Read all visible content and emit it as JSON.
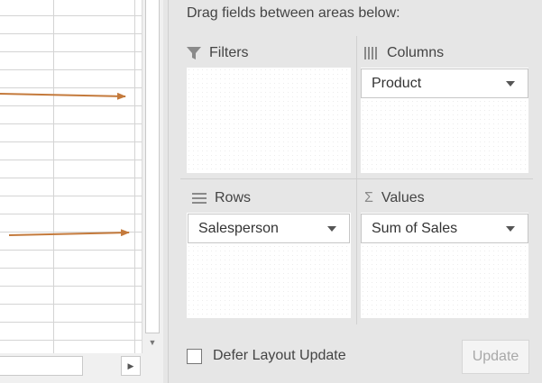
{
  "instruction": "Drag fields between areas below:",
  "areas": {
    "filters": {
      "label": "Filters",
      "icon": "filter-icon"
    },
    "columns": {
      "label": "Columns",
      "icon": "columns-icon",
      "fields": [
        "Product"
      ]
    },
    "rows": {
      "label": "Rows",
      "icon": "rows-icon",
      "fields": [
        "Salesperson"
      ]
    },
    "values": {
      "label": "Values",
      "icon": "sigma-icon",
      "glyph": "Σ",
      "fields": [
        "Sum of Sales"
      ]
    }
  },
  "footer": {
    "defer_label": "Defer Layout Update",
    "defer_checked": false,
    "update_label": "Update",
    "update_enabled": false
  },
  "colors": {
    "arrow": "#c47a3c",
    "pane_bg": "#e6e6e6",
    "disabled_text": "#a8a8a8"
  }
}
